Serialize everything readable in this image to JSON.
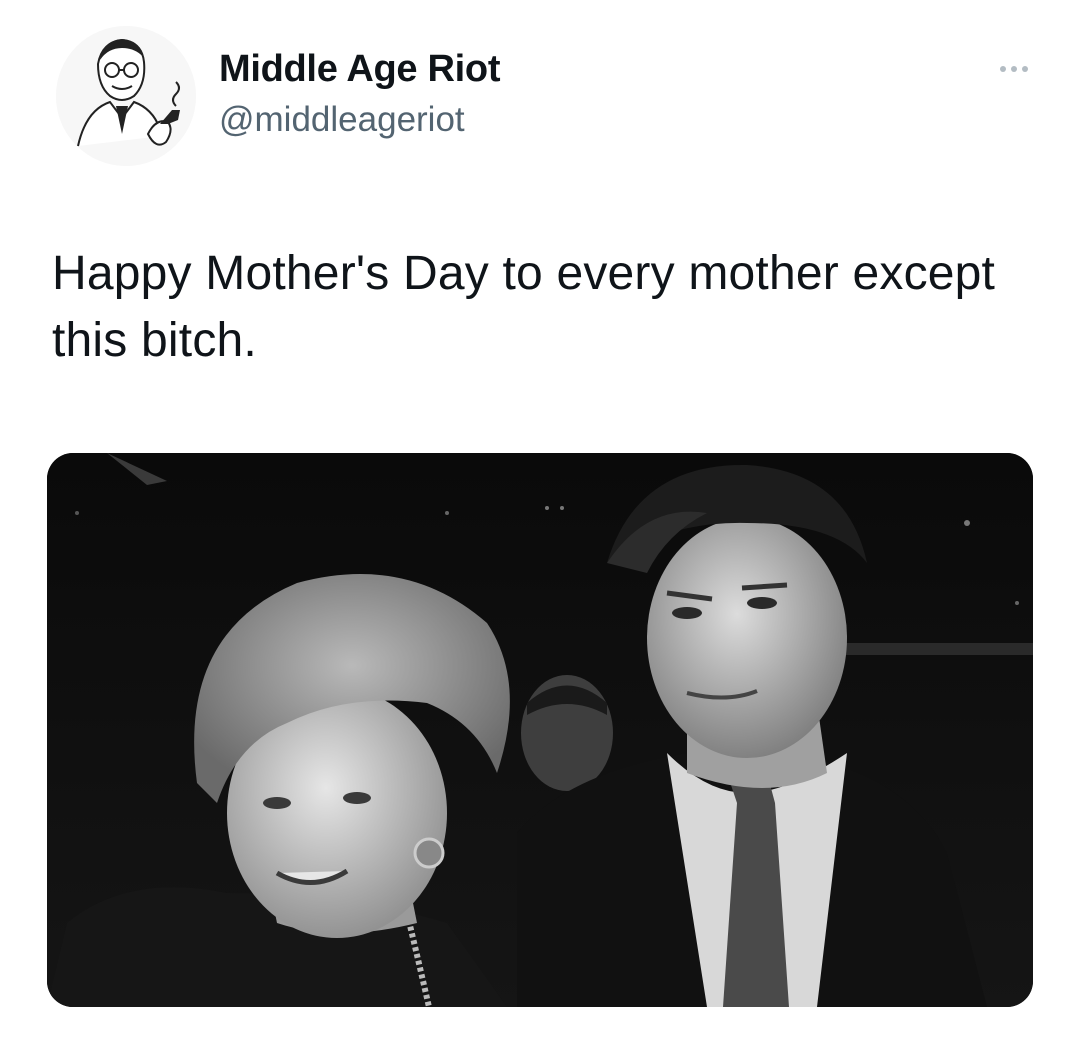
{
  "tweet": {
    "author": {
      "display_name": "Middle Age Riot",
      "handle": "@middleageriot",
      "avatar_icon": "retro-man-smoking-pipe-avatar"
    },
    "more_icon": "ellipsis-icon",
    "text": "Happy Mother's Day to every mother except this bitch.",
    "media": {
      "type": "photo",
      "style": "black-and-white"
    }
  },
  "colors": {
    "text_primary": "#0f1419",
    "text_secondary": "#536471",
    "background": "#ffffff",
    "icon_gray": "#b3bcc3"
  }
}
